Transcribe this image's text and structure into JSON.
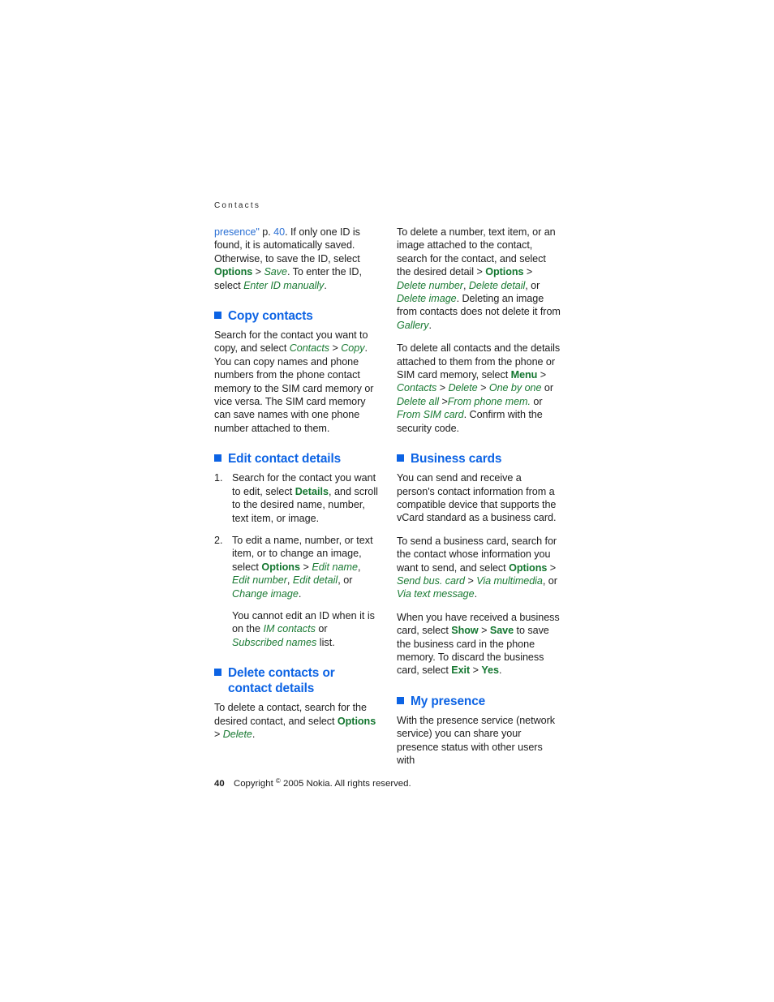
{
  "document": {
    "running_head": "Contacts",
    "page_number": "40",
    "copyright_prefix": "Copyright ",
    "copyright_symbol": "©",
    "copyright_suffix": " 2005 Nokia. All rights reserved."
  },
  "left_column": {
    "intro_paragraph": {
      "p1_link_presence": "presence\"",
      "p1_mid1": " p. ",
      "p1_link_page": "40",
      "p1_mid2": ". If only one ID is found, it is automatically saved. Otherwise, to save the ID, select ",
      "p1_options": "Options",
      "p1_gt1": " > ",
      "p1_save": "Save",
      "p1_mid3": ". To enter the ID, select ",
      "p1_enter_id": "Enter ID manually",
      "p1_end": "."
    },
    "copy_contacts": {
      "heading": "Copy contacts",
      "p1_a": "Search for the contact you want to copy, and select ",
      "p1_contacts": "Contacts",
      "p1_gt": " > ",
      "p1_copy": "Copy",
      "p1_b": ". You can copy names and phone numbers from the phone contact memory to the SIM card memory or vice versa. The SIM card memory can save names with one phone number attached to them."
    },
    "edit_contact_details": {
      "heading": "Edit contact details",
      "step1_a": "Search for the contact you want to edit, select ",
      "step1_details": "Details",
      "step1_b": ", and scroll to the desired name, number, text item, or image.",
      "step2_a": "To edit a name, number, or text item, or to change an image, select ",
      "step2_options": "Options",
      "step2_gt": " > ",
      "step2_edit_name": "Edit name",
      "step2_c1": ", ",
      "step2_edit_number": "Edit number",
      "step2_c2": ", ",
      "step2_edit_detail": "Edit detail",
      "step2_c3": ", or ",
      "step2_change_image": "Change image",
      "step2_end": ".",
      "step2_sub_a": "You cannot edit an ID when it is on the ",
      "step2_sub_im": "IM contacts",
      "step2_sub_b": " or ",
      "step2_sub_subscribed": "Subscribed names",
      "step2_sub_c": " list."
    },
    "delete_contacts": {
      "heading_line1": "Delete contacts or",
      "heading_line2": "contact details",
      "p1_a": "To delete a contact, search for the desired contact, and select ",
      "p1_options": "Options",
      "p1_gt": " > ",
      "p1_delete": "Delete",
      "p1_end": "."
    }
  },
  "right_column": {
    "delete_detail": {
      "p1_a": "To delete a number, text item, or an image attached to the contact, search for the contact, and select the desired detail > ",
      "p1_options": "Options",
      "p1_gt": " > ",
      "p1_delete_number": "Delete number",
      "p1_c1": ", ",
      "p1_delete_detail": "Delete detail",
      "p1_c2": ", or ",
      "p1_delete_image": "Delete image",
      "p1_b": ". Deleting an image from contacts does not delete it from ",
      "p1_gallery": "Gallery",
      "p1_end": "."
    },
    "delete_all": {
      "p1_a": "To delete all contacts and the details attached to them from the phone or SIM card memory, select ",
      "p1_menu": "Menu",
      "p1_gt1": " > ",
      "p1_contacts": "Contacts",
      "p1_gt2": " > ",
      "p1_delete": "Delete",
      "p1_gt3": " > ",
      "p1_one_by_one": "One by one",
      "p1_or1": " or ",
      "p1_delete_all": "Delete all",
      "p1_gt4": " >",
      "p1_from_phone_mem": "From phone mem.",
      "p1_or2": " or ",
      "p1_from_sim_card": "From SIM card",
      "p1_end": ". Confirm with the security code."
    },
    "business_cards": {
      "heading": "Business cards",
      "p1": "You can send and receive a person's contact information from a compatible device that supports the vCard standard as a business card.",
      "p2_a": "To send a business card, search for the contact whose information you want to send, and select ",
      "p2_options": "Options",
      "p2_gt1": " > ",
      "p2_send_bus_card": "Send bus. card",
      "p2_gt2": " > ",
      "p2_via_multimedia": "Via multimedia",
      "p2_or": ", or ",
      "p2_via_text_message": "Via text message",
      "p2_end": ".",
      "p3_a": "When you have received a business card, select ",
      "p3_show": "Show",
      "p3_gt1": " > ",
      "p3_save": "Save",
      "p3_b": " to save the business card in the phone memory. To discard the business card, select ",
      "p3_exit": "Exit",
      "p3_gt2": " > ",
      "p3_yes": "Yes",
      "p3_end": "."
    },
    "my_presence": {
      "heading": "My presence",
      "p1": "With the presence service (network service) you can share your presence status with other users with"
    }
  },
  "colors": {
    "heading_blue": "#0c63e4",
    "ui_green_bold": "#13762f",
    "ui_green_italic": "#1a7a33",
    "link_blue": "#2a6fd4",
    "body_text": "#1c1c1c"
  }
}
